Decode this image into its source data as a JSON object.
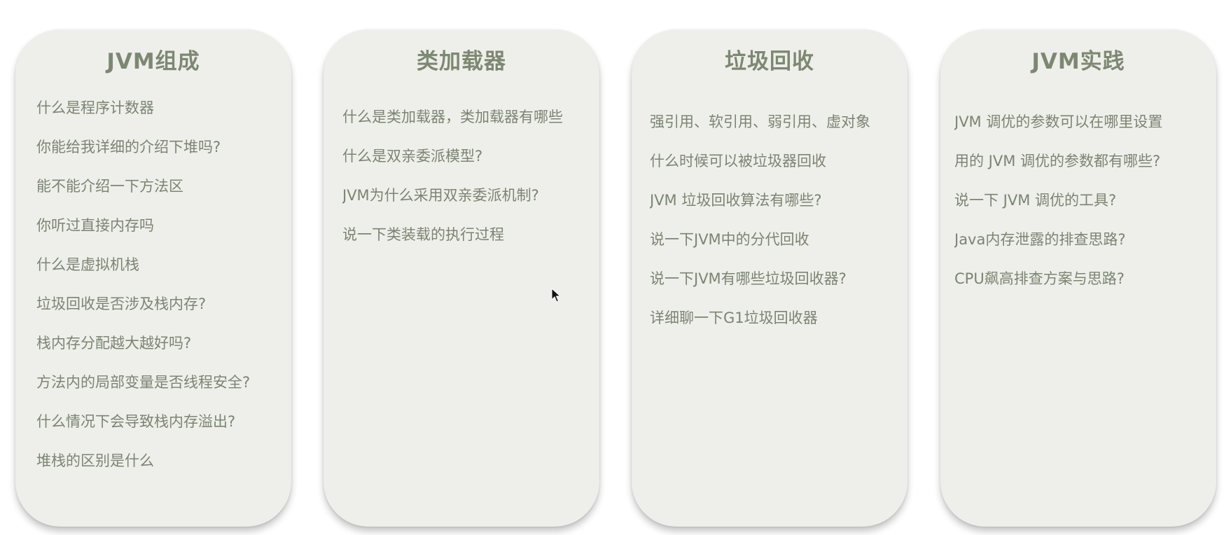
{
  "cards": [
    {
      "title": "JVM组成",
      "items": [
        "什么是程序计数器",
        "你能给我详细的介绍下堆吗?",
        "能不能介绍一下方法区",
        "你听过直接内存吗",
        "什么是虚拟机栈",
        "垃圾回收是否涉及栈内存?",
        "栈内存分配越大越好吗?",
        "方法内的局部变量是否线程安全?",
        "什么情况下会导致栈内存溢出?",
        "堆栈的区别是什么"
      ]
    },
    {
      "title": "类加载器",
      "items": [
        "什么是类加载器，类加载器有哪些",
        "什么是双亲委派模型?",
        "JVM为什么采用双亲委派机制?",
        "说一下类装载的执行过程"
      ]
    },
    {
      "title": "垃圾回收",
      "items": [
        "强引用、软引用、弱引用、虚对象",
        "什么时候可以被垃圾器回收",
        "JVM 垃圾回收算法有哪些?",
        "说一下JVM中的分代回收",
        "说一下JVM有哪些垃圾回收器?",
        "详细聊一下G1垃圾回收器"
      ]
    },
    {
      "title": "JVM实践",
      "items": [
        "JVM 调优的参数可以在哪里设置",
        "用的 JVM 调优的参数都有哪些?",
        "说一下 JVM 调优的工具?",
        "Java内存泄露的排查思路?",
        "CPU飙高排查方案与思路?"
      ]
    }
  ]
}
